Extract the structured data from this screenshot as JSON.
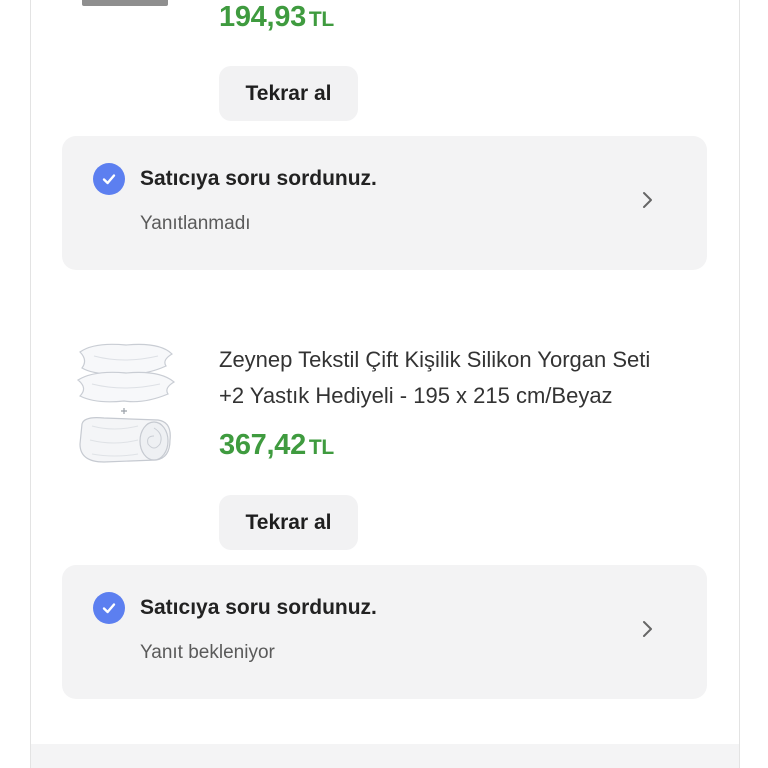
{
  "orders": [
    {
      "price": {
        "amount": "194,93",
        "currency": "TL"
      },
      "rebuy_label": "Tekrar al",
      "question": {
        "title": "Satıcıya soru sordunuz.",
        "status": "Yanıtlanmadı"
      }
    },
    {
      "product_title_line1": "Zeynep Tekstil Çift Kişilik Silikon Yorgan Seti",
      "product_title_line2": "+2 Yastık Hediyeli - 195 x 215 cm/Beyaz",
      "price": {
        "amount": "367,42",
        "currency": "TL"
      },
      "rebuy_label": "Tekrar al",
      "question": {
        "title": "Satıcıya soru sordunuz.",
        "status": "Yanıt bekleniyor"
      }
    }
  ],
  "colors": {
    "price_green": "#3f9b3f",
    "check_blue": "#5c7ff0",
    "panel_bg": "#f3f3f4"
  },
  "icons": {
    "check": "check-circle-icon",
    "chevron": "chevron-right-icon"
  }
}
